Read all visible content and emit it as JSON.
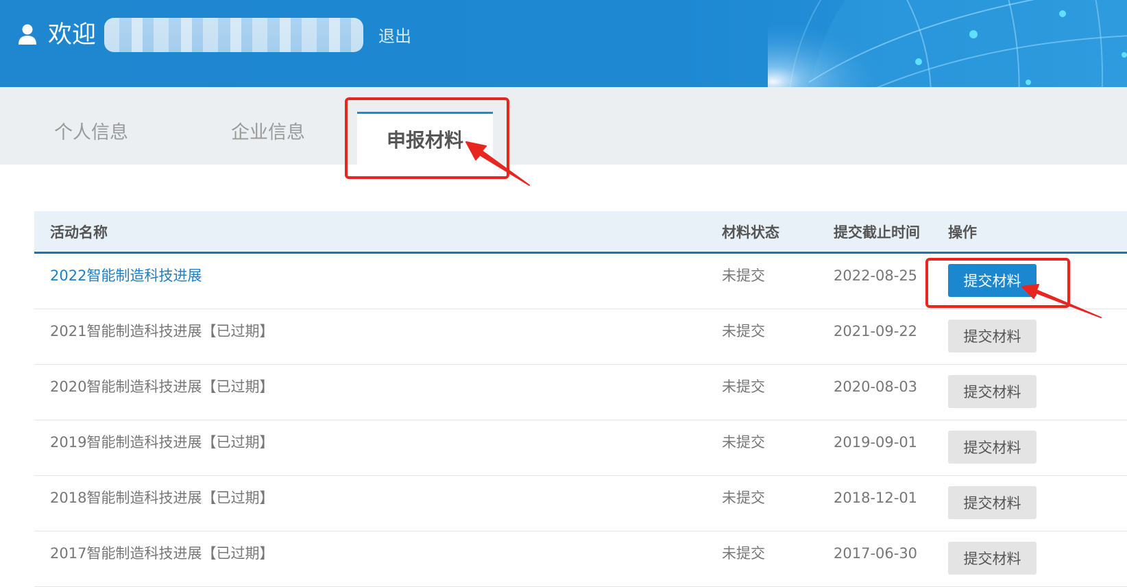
{
  "header": {
    "welcome_text": "欢迎",
    "logout_label": "退出"
  },
  "tabs": [
    {
      "label": "个人信息",
      "active": false
    },
    {
      "label": "企业信息",
      "active": false
    },
    {
      "label": "申报材料",
      "active": true
    }
  ],
  "table": {
    "columns": [
      "活动名称",
      "材料状态",
      "提交截止时间",
      "操作"
    ],
    "rows": [
      {
        "name": "2022智能制造科技进展",
        "status": "未提交",
        "deadline": "2022-08-25",
        "action": "提交材料",
        "active": true
      },
      {
        "name": "2021智能制造科技进展【已过期】",
        "status": "未提交",
        "deadline": "2021-09-22",
        "action": "提交材料",
        "active": false
      },
      {
        "name": "2020智能制造科技进展【已过期】",
        "status": "未提交",
        "deadline": "2020-08-03",
        "action": "提交材料",
        "active": false
      },
      {
        "name": "2019智能制造科技进展【已过期】",
        "status": "未提交",
        "deadline": "2019-09-01",
        "action": "提交材料",
        "active": false
      },
      {
        "name": "2018智能制造科技进展【已过期】",
        "status": "未提交",
        "deadline": "2018-12-01",
        "action": "提交材料",
        "active": false
      },
      {
        "name": "2017智能制造科技进展【已过期】",
        "status": "未提交",
        "deadline": "2017-06-30",
        "action": "提交材料",
        "active": false
      }
    ]
  },
  "icons": {
    "user": "user-icon"
  },
  "colors": {
    "header_blue": "#1e88d3",
    "primary_button": "#1b87cf",
    "link_blue": "#1e7fc6",
    "annotation_red": "#e8261f"
  }
}
